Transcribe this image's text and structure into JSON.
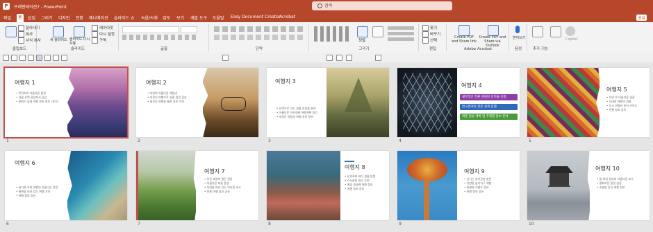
{
  "titlebar": {
    "doc_title": "프레젠테이션7 - PowerPoint",
    "search_placeholder": "검색"
  },
  "menu": [
    "파일",
    "홈",
    "삽입",
    "그리기",
    "디자인",
    "전환",
    "애니메이션",
    "슬라이드 쇼",
    "녹음/녹화",
    "검토",
    "보기",
    "개발 도구",
    "도움말",
    "Easy Document Creator",
    "Acrobat"
  ],
  "ribbon": {
    "clipboard": {
      "label": "클립보드",
      "paste": "붙여넣기",
      "cut": "잘라내기",
      "copy": "복사",
      "format": "서식 복사"
    },
    "slides": {
      "label": "슬라이드",
      "new": "새 슬라이드",
      "reuse": "슬라이드 다시 사용",
      "layout": "레이아웃",
      "reset": "다시 설정",
      "section": "구역"
    },
    "font": {
      "label": "글꼴"
    },
    "paragraph": {
      "label": "단락"
    },
    "drawing": {
      "label": "그리기",
      "arrange": "정렬"
    },
    "editing": {
      "label": "편집",
      "find": "찾기",
      "replace": "바꾸기",
      "select": "선택"
    },
    "acrobat": {
      "label": "Adobe Acrobat",
      "create_pdf": "Create PDF and Share link",
      "create_pdf2": "Create PDF and Share via Outlook"
    },
    "voice": {
      "label": "음성",
      "dictate": "받아쓰기"
    },
    "addins": {
      "label": "추가 기능",
      "addins_btn": "추가 기능",
      "copilot": "Copilot"
    }
  },
  "share_label": "공유",
  "slides": [
    {
      "num": "1",
      "title": "여행지 1",
      "bullets": [
        "목적지의 아름다운 풍경",
        "일몰 산맥 정상에서 감상",
        "분위기 좋게 여행 준비 정보 가이드"
      ]
    },
    {
      "num": "2",
      "title": "여행지 2",
      "bullets": [
        "자연의 아름다운 해질녘",
        "자전거 여행으로 일몰 풍경 감상",
        "새로운 여행을 통한 정보 기억"
      ]
    },
    {
      "num": "3",
      "title": "여행지 3",
      "bullets": [
        "산맥으로 가는 일몰 전망을 분석",
        "아름다운 자연경관 여행계획 정리",
        "새로운 경험과 여행 추천 정보"
      ]
    },
    {
      "num": "4",
      "title": "여행지 4",
      "bullets": [
        "세부적인 경험 편하게 알려줍니다",
        "연구분야 전문가의 연결 정보",
        "최신 탐방 여행 계획 및 주제"
      ],
      "pills": [
        "세부적인 전환 관련된 안목을 신청",
        "연구분야의 전문 검색 진행",
        "여행 탐방 계획 및 주제별 정보 분석"
      ]
    },
    {
      "num": "5",
      "title": "여행지 5",
      "bullets": [
        "자연 속 아름다운 경관",
        "신비한 해변의 마을",
        "도시 여행과 분석 가이드",
        "전통 정보 공유"
      ]
    },
    {
      "num": "6",
      "title": "여행지 6",
      "bullets": [
        "바다와 자연 여행의 아름다운 전망",
        "해변을 따라 걷는 여행 기억",
        "여행 정보 공유"
      ]
    },
    {
      "num": "7",
      "title": "여행지 7",
      "bullets": [
        "푸른 초원의 멋진 경관",
        "아름다운 마을 풍경",
        "자연을 따라 걷는 하이킹 코스",
        "전통 여행 정보 공유"
      ]
    },
    {
      "num": "8",
      "title": "여행지 8",
      "bullets": [
        "산호초와 바다 생물 탐험",
        "스노클링 명소 추천",
        "해양 생태계 여행 정보",
        "여행 정보 공유"
      ]
    },
    {
      "num": "9",
      "title": "여행지 9",
      "bullets": [
        "신나는 놀이공원 방문",
        "다양한 놀이기구 체험",
        "축제와 이벤트 정보",
        "여행 정보 공유"
      ]
    },
    {
      "num": "10",
      "title": "여행지 10",
      "bullets": [
        "물 위의 정자와 아름다운 호수",
        "평화로운 풍경 감상",
        "조용한 휴식 여행 정보"
      ]
    }
  ]
}
